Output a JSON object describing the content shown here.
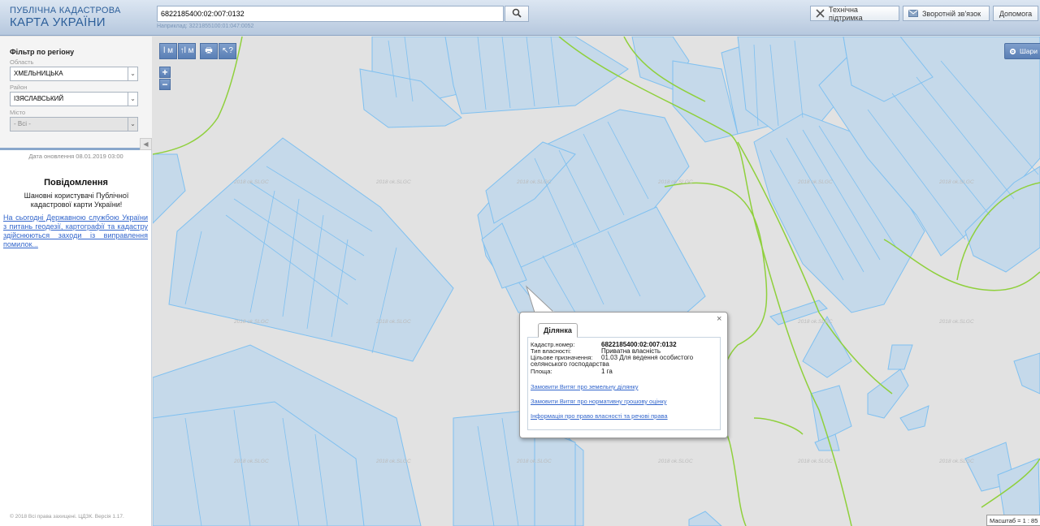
{
  "header": {
    "logo_line1": "ПУБЛІЧНА КАДАСТРОВА",
    "logo_line2": "КАРТА УКРАЇНИ",
    "search_value": "6822185400:02:007:0132",
    "search_hint": "Наприклад: 3221855100:01:047:0052",
    "buttons": {
      "support": "Технічна підтримка",
      "feedback": "Зворотній зв'язок",
      "help": "Допомога"
    }
  },
  "sidebar": {
    "filter_title": "Фільтр по регіону",
    "region_label": "Область",
    "region_value": "ХМЕЛЬНИЦЬКА",
    "district_label": "Район",
    "district_value": "ІЗЯСЛАВСЬКИЙ",
    "city_label": "Місто",
    "city_value": "- Всі -",
    "updated": "Дата оновлення  08.01.2019 03:00",
    "notice_title": "Повідомлення",
    "notice_text": "Шановні користувачі Публічної кадастрової карти України!",
    "notice_link": "На сьогодні Державною службою України з питань геодезії, картографії та кадастру здійснюються заходи із виправлення помилок...",
    "copyright": "© 2018 Всі права захищені. ЦДЗК. Версія 1.17."
  },
  "map": {
    "tools": [
      "l м",
      "↑l м",
      "🖶",
      "↖?"
    ],
    "zoom_in": "+",
    "zoom_out": "−",
    "layers_label": "Шари",
    "watermark": "2018 ok.SLGC",
    "scale": "Масштаб = 1 : 85",
    "colors": {
      "parcel_fill": "#c5d9ea",
      "parcel_stroke": "#7fc0f0",
      "boundary": "#8fd03c"
    }
  },
  "popup": {
    "tab": "Ділянка",
    "fields": [
      {
        "label": "Кадастр.номер:",
        "value": "6822185400:02:007:0132"
      },
      {
        "label": "Тип власності:",
        "value": "Приватна власність"
      },
      {
        "label": "Цільове призначення:",
        "value": "01.03 Для ведення особистого селянського господарства"
      },
      {
        "label": "Площа:",
        "value": "1 га"
      }
    ],
    "links": [
      "Замовити Витяг про земельну ділянку",
      "Замовити Витяг про нормативну грошову оцінку",
      "Інформація про право власності та речові права"
    ],
    "close": "×"
  }
}
